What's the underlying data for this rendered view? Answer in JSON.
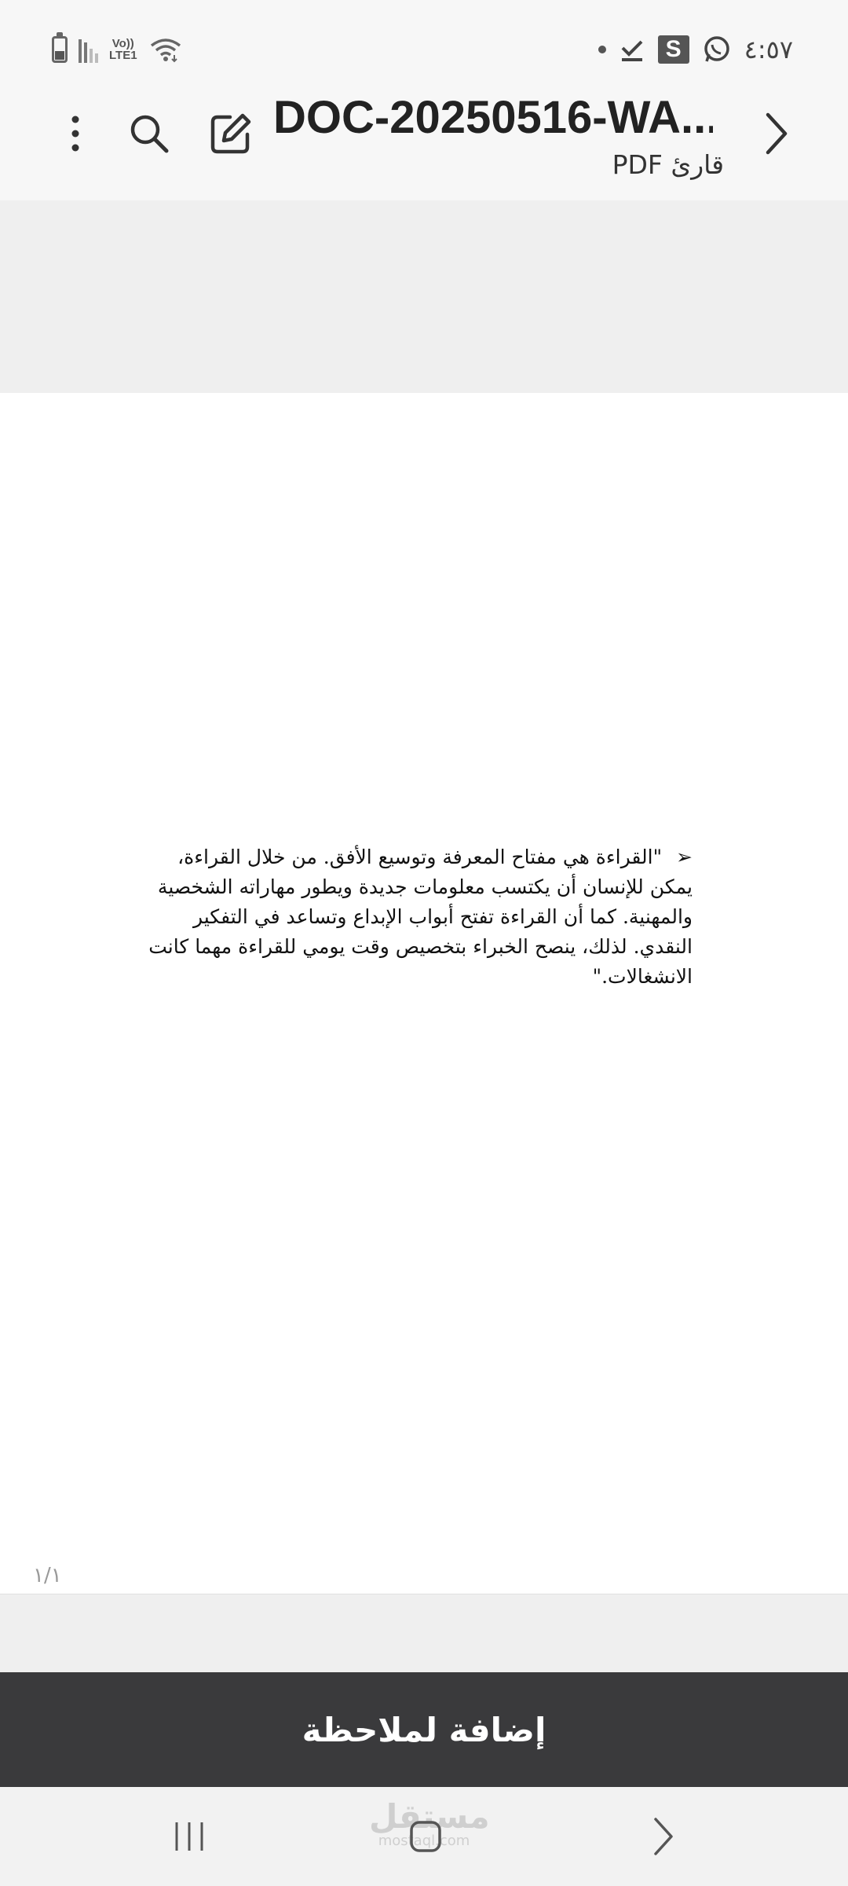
{
  "status_bar": {
    "time": "٤:٥٧",
    "network_label": "Vo)) LTE1",
    "network_top": "Vo))",
    "network_bottom": "LTE1",
    "icons": [
      "battery-icon",
      "signal-icon",
      "wifi-icon",
      "dot-icon",
      "check-notification-icon",
      "s-app-icon",
      "whatsapp-icon"
    ],
    "s_badge": "S"
  },
  "app_bar": {
    "title": "DOC-20250516-WA...",
    "subtitle": "قارئ PDF",
    "icons": [
      "more-options-icon",
      "search-icon",
      "edit-icon",
      "back-arrow-icon"
    ]
  },
  "document": {
    "bullet": "➢",
    "paragraph": "\"القراءة هي مفتاح المعرفة وتوسيع الأفق. من خلال القراءة، يمكن للإنسان أن يكتسب معلومات جديدة ويطور مهاراته الشخصية والمهنية. كما أن القراءة تفتح أبواب الإبداع وتساعد في التفكير النقدي. لذلك، ينصح الخبراء بتخصيص وقت يومي للقراءة مهما كانت الانشغالات.\"",
    "page_indicator": "١/١"
  },
  "note_bar": {
    "label": "إضافة لملاحظة"
  },
  "nav_bar": {
    "icons": [
      "recent-apps-icon",
      "home-icon",
      "back-icon"
    ],
    "watermark_main": "مستقل",
    "watermark_sub": "mostaql.com"
  },
  "colors": {
    "app_bar_bg": "#f7f7f7",
    "gray_band": "#efefef",
    "note_bar_bg": "#3a3a3c",
    "nav_bar_bg": "#f2f2f2"
  }
}
